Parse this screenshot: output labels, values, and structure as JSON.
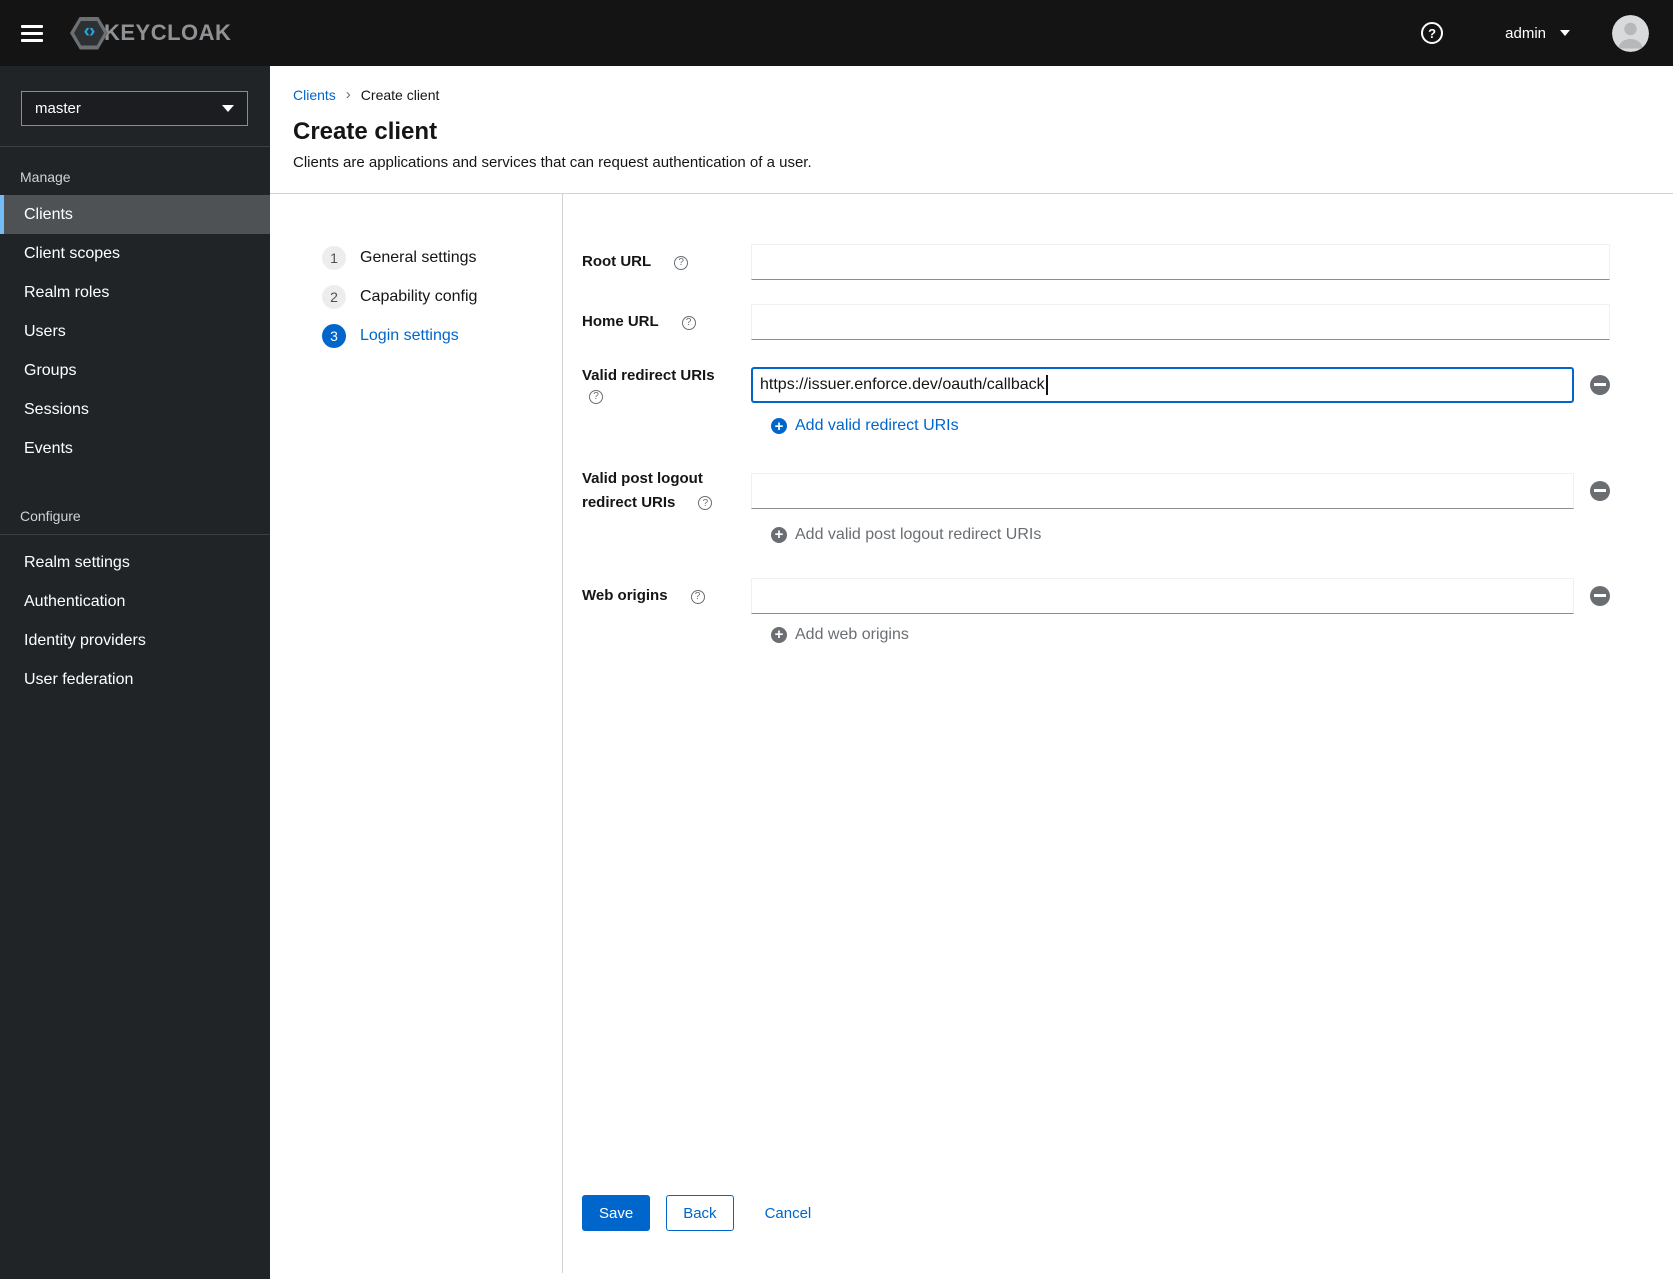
{
  "topbar": {
    "brand_text": "KEYCLOAK",
    "brand_glyph": "‹›",
    "help_glyph": "?",
    "username": "admin"
  },
  "sidebar": {
    "realm": "master",
    "sections": [
      {
        "title": "Manage",
        "items": [
          {
            "label": "Clients"
          },
          {
            "label": "Client scopes"
          },
          {
            "label": "Realm roles"
          },
          {
            "label": "Users"
          },
          {
            "label": "Groups"
          },
          {
            "label": "Sessions"
          },
          {
            "label": "Events"
          }
        ]
      },
      {
        "title": "Configure",
        "items": [
          {
            "label": "Realm settings"
          },
          {
            "label": "Authentication"
          },
          {
            "label": "Identity providers"
          },
          {
            "label": "User federation"
          }
        ]
      }
    ],
    "selected_item": "Clients"
  },
  "breadcrumb": {
    "parent": "Clients",
    "separator": "›",
    "current": "Create client"
  },
  "page": {
    "title": "Create client",
    "description": "Clients are applications and services that can request authentication of a user."
  },
  "wizard": {
    "active_step": "3",
    "steps": [
      {
        "number": "1",
        "label": "General settings"
      },
      {
        "number": "2",
        "label": "Capability config"
      },
      {
        "number": "3",
        "label": "Login settings"
      }
    ]
  },
  "form": {
    "help_glyph": "?",
    "root_url": {
      "label": "Root URL",
      "value": ""
    },
    "home_url": {
      "label": "Home URL",
      "value": ""
    },
    "valid_redirect_uris": {
      "label": "Valid redirect URIs",
      "value": "https://issuer.enforce.dev/oauth/callback",
      "add_label": "Add valid redirect URIs"
    },
    "valid_post_logout_redirect_uris": {
      "label": "Valid post logout redirect URIs",
      "value": "",
      "add_label": "Add valid post logout redirect URIs"
    },
    "web_origins": {
      "label": "Web origins",
      "value": "",
      "add_label": "Add web origins"
    }
  },
  "actions": {
    "save": "Save",
    "back": "Back",
    "cancel": "Cancel"
  },
  "colors": {
    "primary_blue": "#0066cc",
    "sidebar_selected_accent": "#73bcf7",
    "topbar_bg": "#141414",
    "sidebar_bg": "#212427",
    "disabled_text": "#6a6e73",
    "divider": "#d2d2d2"
  }
}
